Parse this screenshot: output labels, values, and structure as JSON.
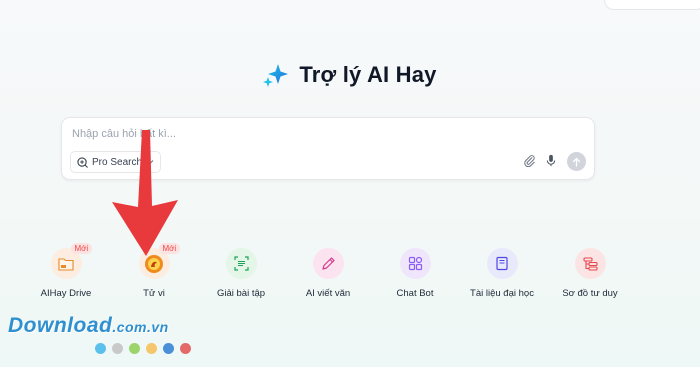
{
  "header": {
    "title": "Trợ lý AI Hay"
  },
  "search": {
    "placeholder": "Nhập câu hỏi bất kì...",
    "pro_label": "Pro Search"
  },
  "tools": [
    {
      "label": "AIHay Drive",
      "badge": "Mới",
      "icon": "folder-icon"
    },
    {
      "label": "Tử vi",
      "badge": "Mới",
      "icon": "horoscope-icon"
    },
    {
      "label": "Giải bài tập",
      "badge": "",
      "icon": "scan-icon"
    },
    {
      "label": "AI viết văn",
      "badge": "",
      "icon": "pen-icon"
    },
    {
      "label": "Chat Bot",
      "badge": "",
      "icon": "grid-icon"
    },
    {
      "label": "Tài liệu đại học",
      "badge": "",
      "icon": "book-icon"
    },
    {
      "label": "Sơ đồ tư duy",
      "badge": "",
      "icon": "mindmap-icon"
    }
  ],
  "watermark": {
    "brand": "Download",
    "domain": ".com.vn"
  },
  "colors": {
    "accent": "#2563eb",
    "arrow": "#e8393c",
    "badge_bg": "#fde2e2",
    "badge_text": "#ef4444",
    "dots": [
      "#5bc0eb",
      "#c9c9c9",
      "#9bd46a",
      "#f5c66b",
      "#4a90d9",
      "#e46a6a"
    ]
  }
}
